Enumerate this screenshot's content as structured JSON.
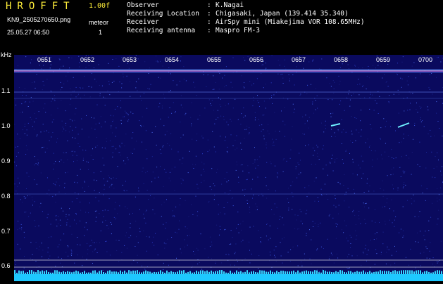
{
  "header": {
    "brand": "HROFFT",
    "version": "1.00f",
    "filename": "KN9_2505270650.png",
    "timestamp": "25.05.27 06:50",
    "mode_label": "meteor",
    "mode_value": "1"
  },
  "station_info": [
    {
      "key": "Observer",
      "value": "K.Nagai"
    },
    {
      "key": "Receiving Location",
      "value": "Chigasaki, Japan (139.414 35.340)"
    },
    {
      "key": "Receiver",
      "value": "AirSpy mini (Miakejima VOR 108.65MHz)"
    },
    {
      "key": "Receiving antenna",
      "value": "Maspro FM-3"
    }
  ],
  "yaxis": {
    "unit": "kHz",
    "ticks": [
      "1.1",
      "1.0",
      "0.9",
      "0.8",
      "0.7",
      "0.6"
    ]
  },
  "time_ticks": [
    "0651",
    "0652",
    "0653",
    "0654",
    "0655",
    "0656",
    "0657",
    "0658",
    "0659",
    "0700"
  ],
  "colors": {
    "background": "#000000",
    "spectrogram": "#0a0a5e",
    "brand": "#ffef3a",
    "text": "#ffffff",
    "signal": "#4ee8ff"
  }
}
